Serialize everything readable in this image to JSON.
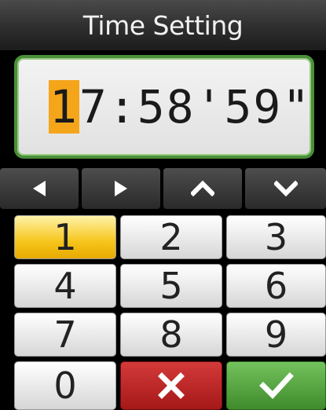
{
  "header": {
    "title": "Time Setting"
  },
  "display": {
    "selected_digit": "1",
    "rest": "7:58'59\""
  },
  "nav": {
    "left_icon": "triangle-left-icon",
    "right_icon": "triangle-right-icon",
    "up_icon": "chevron-up-icon",
    "down_icon": "chevron-down-icon"
  },
  "keypad": {
    "k1": "1",
    "k2": "2",
    "k3": "3",
    "k4": "4",
    "k5": "5",
    "k6": "6",
    "k7": "7",
    "k8": "8",
    "k9": "9",
    "k0": "0",
    "cancel_icon": "close-icon",
    "ok_icon": "checkmark-icon"
  },
  "colors": {
    "selected_digit_bg": "#f5a51a",
    "display_border": "#4a8f3a",
    "cancel_bg": "#c12a2a",
    "ok_bg": "#5aa843",
    "selected_key_bg": "#f6c51d"
  }
}
